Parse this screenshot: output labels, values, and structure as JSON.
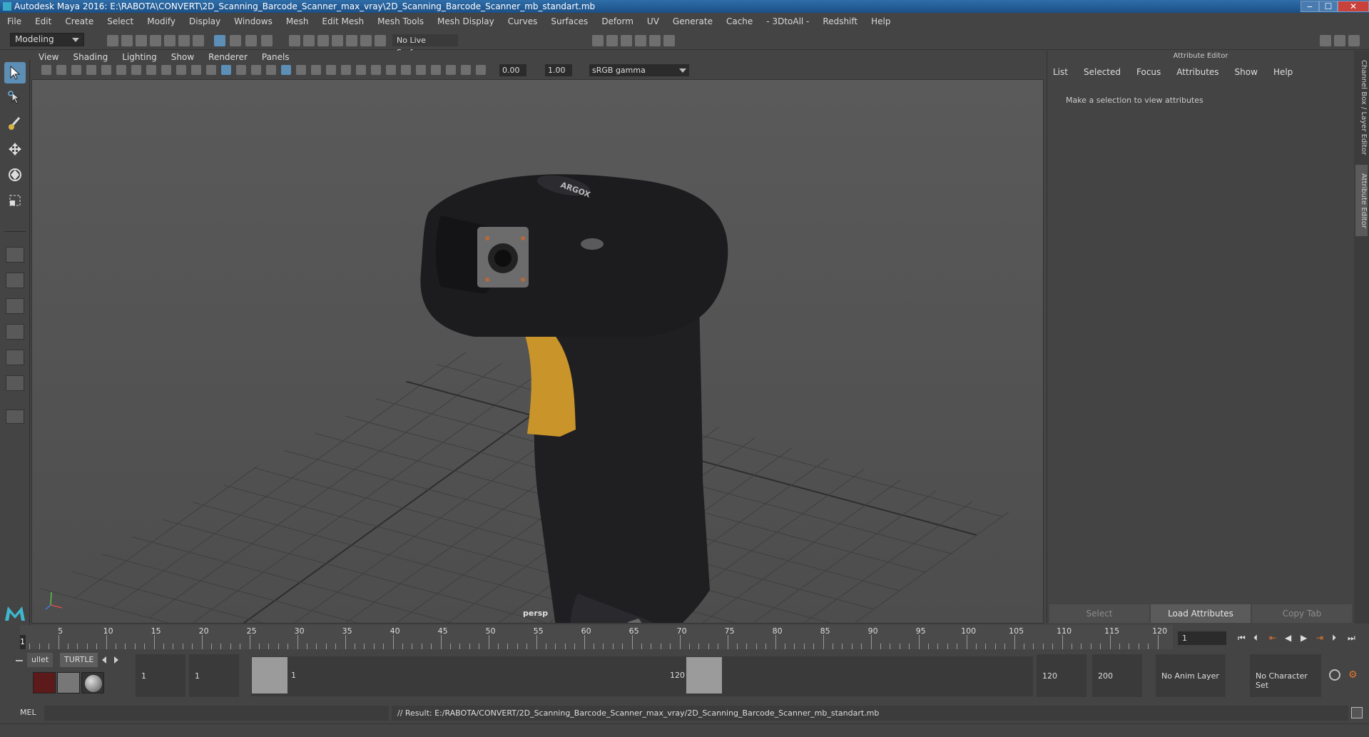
{
  "window": {
    "title": "Autodesk Maya 2016: E:\\RABOTA\\CONVERT\\2D_Scanning_Barcode_Scanner_max_vray\\2D_Scanning_Barcode_Scanner_mb_standart.mb",
    "minimize": "‒",
    "maximize": "☐",
    "close": "✕"
  },
  "menubar": [
    "File",
    "Edit",
    "Create",
    "Select",
    "Modify",
    "Display",
    "Windows",
    "Mesh",
    "Edit Mesh",
    "Mesh Tools",
    "Mesh Display",
    "Curves",
    "Surfaces",
    "Deform",
    "UV",
    "Generate",
    "Cache",
    "- 3DtoAll -",
    "Redshift",
    "Help"
  ],
  "status": {
    "mode": "Modeling",
    "live_surface": "No Live Surface"
  },
  "panel_menu": [
    "View",
    "Shading",
    "Lighting",
    "Show",
    "Renderer",
    "Panels"
  ],
  "view_bar": {
    "exposure": "0.00",
    "gamma": "1.00",
    "color_space": "sRGB gamma"
  },
  "viewport": {
    "camera": "persp",
    "product_logo": "ARGOX"
  },
  "attribute_editor": {
    "title": "Attribute Editor",
    "menu": [
      "List",
      "Selected",
      "Focus",
      "Attributes",
      "Show",
      "Help"
    ],
    "message": "Make a selection to view attributes",
    "buttons": [
      "Select",
      "Load Attributes",
      "Copy Tab"
    ]
  },
  "side_tabs": [
    "Channel Box / Layer Editor",
    "Attribute Editor"
  ],
  "timeline": {
    "ticks": [
      "5",
      "10",
      "15",
      "20",
      "25",
      "30",
      "35",
      "40",
      "45",
      "50",
      "55",
      "60",
      "65",
      "70",
      "75",
      "80",
      "85",
      "90",
      "95",
      "100",
      "105",
      "110",
      "115",
      "120"
    ],
    "start_label": "1",
    "current_frame": "1"
  },
  "range": {
    "shelf_tabs": [
      "ullet",
      "TURTLE"
    ],
    "start": "1",
    "playback_start": "1",
    "handle_start": "1",
    "handle_end": "120",
    "playback_end": "120",
    "end": "200",
    "anim_layer": "No Anim Layer",
    "char_set": "No Character Set"
  },
  "command": {
    "label": "MEL",
    "result": "// Result: E:/RABOTA/CONVERT/2D_Scanning_Barcode_Scanner_max_vray/2D_Scanning_Barcode_Scanner_mb_standart.mb"
  }
}
